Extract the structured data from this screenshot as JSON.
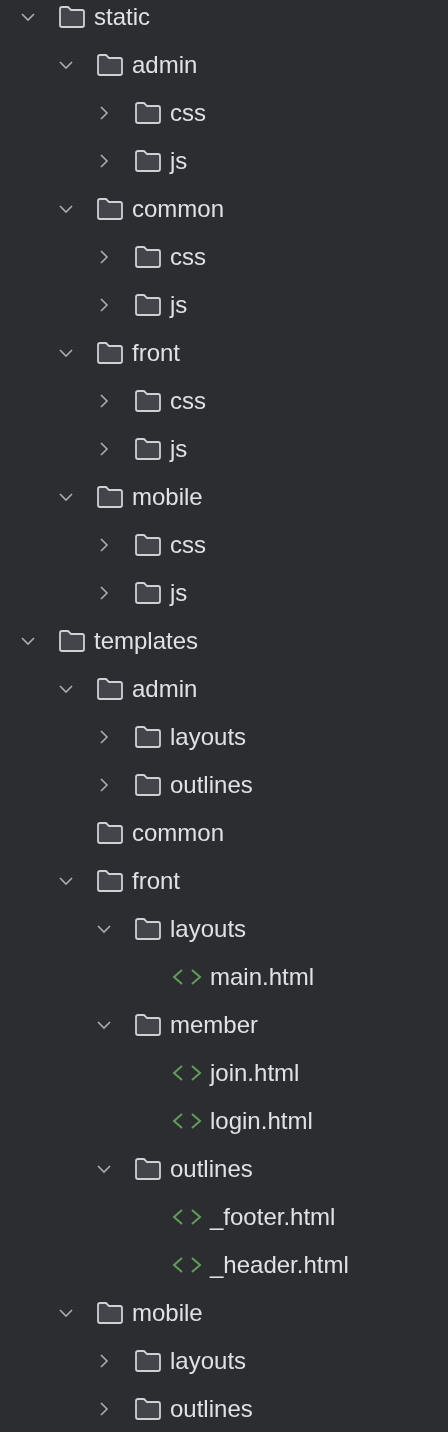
{
  "tree": [
    {
      "kind": "folder",
      "name": "static",
      "expanded": true,
      "children": [
        {
          "kind": "folder",
          "name": "admin",
          "expanded": true,
          "children": [
            {
              "kind": "folder",
              "name": "css",
              "expanded": false
            },
            {
              "kind": "folder",
              "name": "js",
              "expanded": false
            }
          ]
        },
        {
          "kind": "folder",
          "name": "common",
          "expanded": true,
          "children": [
            {
              "kind": "folder",
              "name": "css",
              "expanded": false
            },
            {
              "kind": "folder",
              "name": "js",
              "expanded": false
            }
          ]
        },
        {
          "kind": "folder",
          "name": "front",
          "expanded": true,
          "children": [
            {
              "kind": "folder",
              "name": "css",
              "expanded": false
            },
            {
              "kind": "folder",
              "name": "js",
              "expanded": false
            }
          ]
        },
        {
          "kind": "folder",
          "name": "mobile",
          "expanded": true,
          "children": [
            {
              "kind": "folder",
              "name": "css",
              "expanded": false
            },
            {
              "kind": "folder",
              "name": "js",
              "expanded": false
            }
          ]
        }
      ]
    },
    {
      "kind": "folder",
      "name": "templates",
      "expanded": true,
      "children": [
        {
          "kind": "folder",
          "name": "admin",
          "expanded": true,
          "children": [
            {
              "kind": "folder",
              "name": "layouts",
              "expanded": false
            },
            {
              "kind": "folder",
              "name": "outlines",
              "expanded": false
            }
          ]
        },
        {
          "kind": "empty-folder",
          "name": "common"
        },
        {
          "kind": "folder",
          "name": "front",
          "expanded": true,
          "children": [
            {
              "kind": "folder",
              "name": "layouts",
              "expanded": true,
              "children": [
                {
                  "kind": "html-file",
                  "name": "main.html"
                }
              ]
            },
            {
              "kind": "folder",
              "name": "member",
              "expanded": true,
              "children": [
                {
                  "kind": "html-file",
                  "name": "join.html"
                },
                {
                  "kind": "html-file",
                  "name": "login.html"
                }
              ]
            },
            {
              "kind": "folder",
              "name": "outlines",
              "expanded": true,
              "children": [
                {
                  "kind": "html-file",
                  "name": "_footer.html"
                },
                {
                  "kind": "html-file",
                  "name": "_header.html"
                }
              ]
            }
          ]
        },
        {
          "kind": "folder",
          "name": "mobile",
          "expanded": true,
          "children": [
            {
              "kind": "folder",
              "name": "layouts",
              "expanded": false
            },
            {
              "kind": "folder",
              "name": "outlines",
              "expanded": false
            }
          ]
        }
      ]
    }
  ]
}
